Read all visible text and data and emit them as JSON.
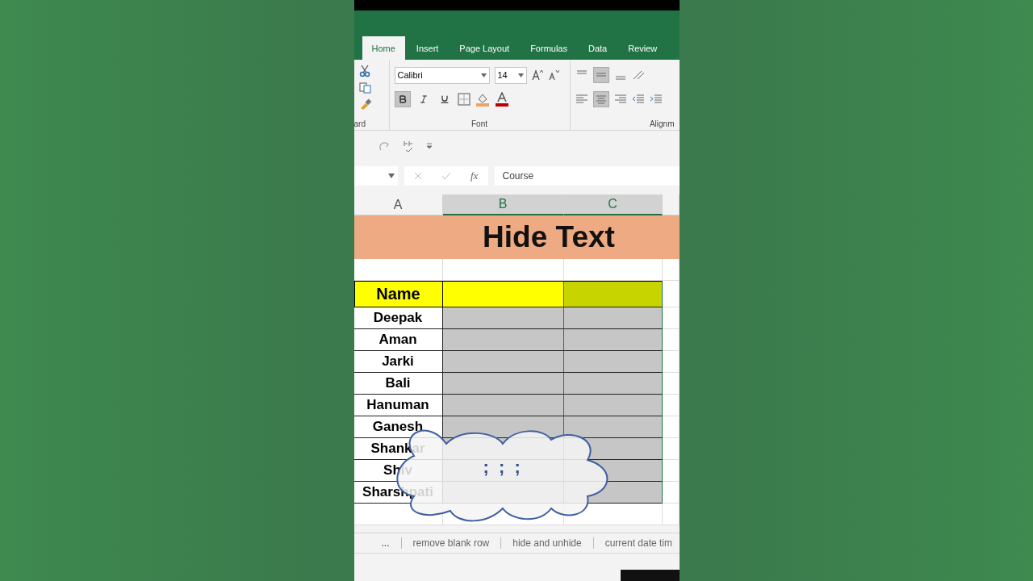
{
  "ribbon_tabs": [
    {
      "label": "Home",
      "selected": true
    },
    {
      "label": "Insert",
      "selected": false
    },
    {
      "label": "Page Layout",
      "selected": false
    },
    {
      "label": "Formulas",
      "selected": false
    },
    {
      "label": "Data",
      "selected": false
    },
    {
      "label": "Review",
      "selected": false
    }
  ],
  "font": {
    "name": "Calibri",
    "size": "14",
    "bold": true,
    "italic": false,
    "underline": false
  },
  "alignment": {
    "middle_selected": true,
    "center_selected": true
  },
  "group_labels": [
    "ard",
    "Font",
    "Alignm"
  ],
  "formula_bar": {
    "function_label": "fx",
    "value": "Course"
  },
  "columns": [
    {
      "label": "A",
      "selected": false
    },
    {
      "label": "B",
      "selected": true
    },
    {
      "label": "C",
      "selected": true
    }
  ],
  "title": "Hide Text",
  "header": "Name",
  "names": [
    "Deepak",
    "Aman",
    "Jarki",
    "Bali",
    "Hanuman",
    "Ganesh",
    "Shankar",
    "Shiv",
    "Sharshpati"
  ],
  "callout": {
    "text": ";  ;  ;"
  },
  "sheet_tabs": [
    "...",
    "remove blank row",
    "hide and unhide",
    "current date tim"
  ]
}
